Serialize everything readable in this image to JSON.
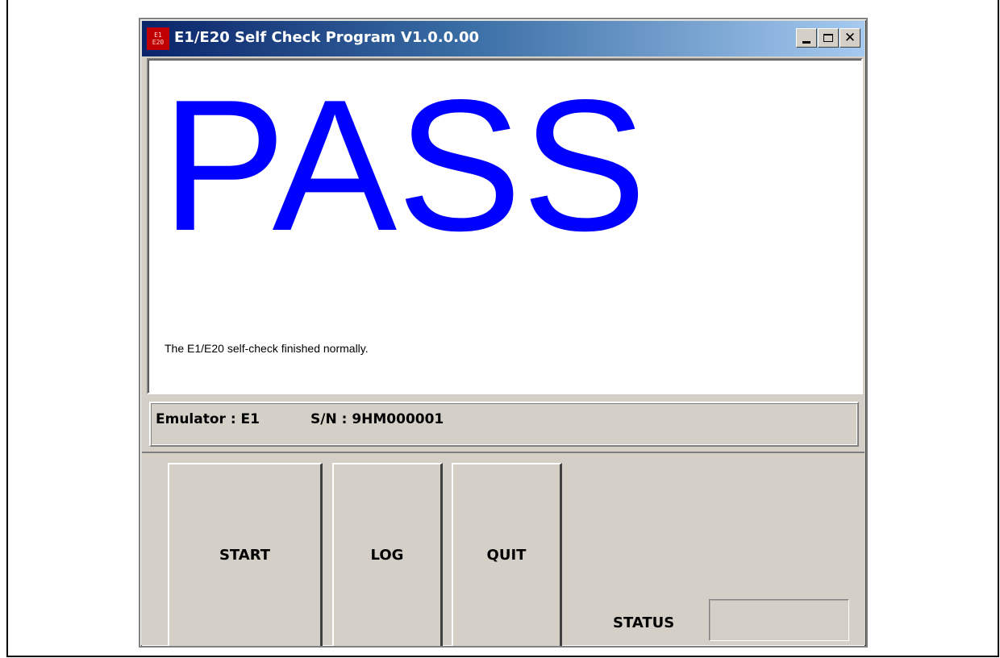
{
  "window": {
    "title": "E1/E20 Self Check Program V1.0.0.00",
    "app_icon": {
      "name": "e1-e20-app-icon",
      "lines": [
        "E1",
        "E20"
      ]
    },
    "controls": {
      "minimize": "minimize-icon",
      "maximize": "maximize-icon",
      "close": "close-icon"
    }
  },
  "result": {
    "verdict": "PASS",
    "verdict_color": "#0000ff",
    "message": "The E1/E20 self-check finished normally."
  },
  "info": {
    "emulator": "Emulator : E1",
    "serial": "S/N : 9HM000001"
  },
  "buttons": {
    "start": "START",
    "log": "LOG",
    "quit": "QUIT"
  },
  "status": {
    "label": "STATUS",
    "value": ""
  }
}
